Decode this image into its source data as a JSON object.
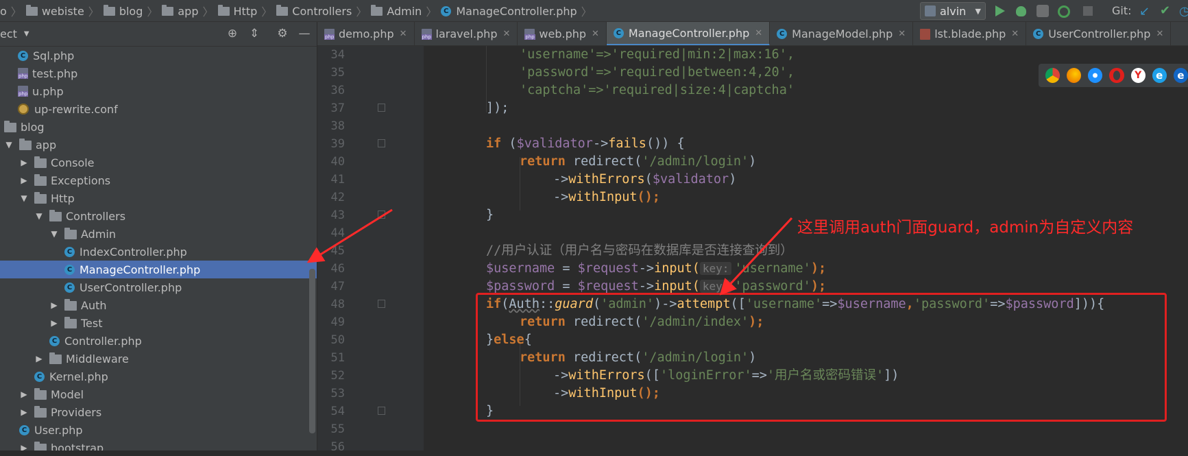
{
  "breadcrumbs": [
    "webiste",
    "blog",
    "app",
    "Http",
    "Controllers",
    "Admin",
    "ManageController.php"
  ],
  "breadcrumb_lead": "o",
  "toolbar": {
    "run_config": "alvin",
    "git_label": "Git:"
  },
  "project_panel": {
    "title": "ect",
    "items": [
      {
        "label": "Sql.php",
        "icon": "class-icon",
        "arrow": ""
      },
      {
        "label": "test.php",
        "icon": "php-file-icon",
        "arrow": ""
      },
      {
        "label": "u.php",
        "icon": "php-file-icon",
        "arrow": ""
      },
      {
        "label": "up-rewrite.conf",
        "icon": "config-file-icon",
        "arrow": ""
      },
      {
        "label": "blog",
        "icon": "folder-icon",
        "arrow": ""
      },
      {
        "label": "app",
        "icon": "folder-icon",
        "arrow": "expanded"
      },
      {
        "label": "Console",
        "icon": "folder-icon",
        "arrow": "collapsed"
      },
      {
        "label": "Exceptions",
        "icon": "folder-icon",
        "arrow": "collapsed"
      },
      {
        "label": "Http",
        "icon": "folder-icon",
        "arrow": "expanded"
      },
      {
        "label": "Controllers",
        "icon": "folder-icon",
        "arrow": "expanded"
      },
      {
        "label": "Admin",
        "icon": "folder-icon",
        "arrow": "expanded"
      },
      {
        "label": "IndexController.php",
        "icon": "class-icon",
        "arrow": ""
      },
      {
        "label": "ManageController.php",
        "icon": "class-icon",
        "arrow": "",
        "selected": true
      },
      {
        "label": "UserController.php",
        "icon": "class-icon",
        "arrow": ""
      },
      {
        "label": "Auth",
        "icon": "folder-icon",
        "arrow": "collapsed"
      },
      {
        "label": "Test",
        "icon": "folder-icon",
        "arrow": "collapsed"
      },
      {
        "label": "Controller.php",
        "icon": "class-icon",
        "arrow": ""
      },
      {
        "label": "Middleware",
        "icon": "folder-icon",
        "arrow": "collapsed"
      },
      {
        "label": "Kernel.php",
        "icon": "class-icon",
        "arrow": ""
      },
      {
        "label": "Model",
        "icon": "folder-icon",
        "arrow": "collapsed"
      },
      {
        "label": "Providers",
        "icon": "folder-icon",
        "arrow": "collapsed"
      },
      {
        "label": "User.php",
        "icon": "class-icon",
        "arrow": ""
      },
      {
        "label": "bootstrap",
        "icon": "folder-icon",
        "arrow": "collapsed"
      }
    ]
  },
  "tabs": [
    {
      "label": "demo.php",
      "icon": "php-file-icon"
    },
    {
      "label": "laravel.php",
      "icon": "php-file-icon"
    },
    {
      "label": "web.php",
      "icon": "php-file-icon"
    },
    {
      "label": "ManageController.php",
      "icon": "class-icon",
      "active": true
    },
    {
      "label": "ManageModel.php",
      "icon": "class-icon"
    },
    {
      "label": "lst.blade.php",
      "icon": "blade-file-icon"
    },
    {
      "label": "UserController.php",
      "icon": "class-icon"
    }
  ],
  "code": {
    "line_numbers": [
      "34",
      "35",
      "36",
      "37",
      "38",
      "39",
      "40",
      "41",
      "42",
      "43",
      "44",
      "45",
      "46",
      "47",
      "48",
      "49",
      "50",
      "51",
      "52",
      "53",
      "54",
      "55",
      "56"
    ],
    "l34": "'username'=>'required|min:2|max:16',",
    "l35": "'password'=>'required|between:4,20',",
    "l36": "'captcha'=>'required|size:4|captcha'",
    "l37": "]);",
    "l39_kw": "if",
    "l39_rest1": " (",
    "l39_var": "$validator",
    "l39_arrow": "->",
    "l39_fn": "fails",
    "l39_rest2": "()) {",
    "l40_kw": "return",
    "l40_rest": " redirect(",
    "l40_str": "'/admin/login'",
    "l40_end": ")",
    "l41_arrow": "->",
    "l41_fn": "withErrors",
    "l41_p1": "(",
    "l41_var": "$validator",
    "l41_p2": ")",
    "l42_arrow": "->",
    "l42_fn": "withInput",
    "l42_end": "();",
    "l43": "}",
    "l45": "//用户认证（用户名与密码在数据库是否连接查询到）",
    "l46_var": "$username",
    "l46_eq": " = ",
    "l46_var2": "$request",
    "l46_arrow": "->",
    "l46_fn": "input(",
    "l46_hint": "key:",
    "l46_str": "'username'",
    "l46_end": ");",
    "l47_var": "$password",
    "l47_eq": " = ",
    "l47_var2": "$request",
    "l47_arrow": "->",
    "l47_fn": "input(",
    "l47_hint": "key:",
    "l47_str": "'password'",
    "l47_end": ");",
    "l48_kw": "if",
    "l48_p": "(",
    "l48_cls": "Auth",
    "l48_dc": "::",
    "l48_fn": "guard",
    "l48_a": "(",
    "l48_s1": "'admin'",
    "l48_b": ")->",
    "l48_fn2": "attempt",
    "l48_c": "([",
    "l48_s2": "'username'",
    "l48_d": "=>",
    "l48_v1": "$username",
    "l48_e": ",",
    "l48_s3": "'password'",
    "l48_f": "=>",
    "l48_v2": "$password",
    "l48_g": "])){",
    "l49_kw": "return",
    "l49_rest": " redirect(",
    "l49_str": "'/admin/index'",
    "l49_end": ");",
    "l50_a": "}",
    "l50_kw": "else",
    "l50_b": "{",
    "l51_kw": "return",
    "l51_rest": " redirect(",
    "l51_str": "'/admin/login'",
    "l51_end": ")",
    "l52_arrow": "->",
    "l52_fn": "withErrors",
    "l52_a": "([",
    "l52_s1": "'loginError'",
    "l52_b": "=>",
    "l52_s2": "'用户名或密码错误'",
    "l52_c": "])",
    "l53_arrow": "->",
    "l53_fn": "withInput",
    "l53_end": "();",
    "l54": "}"
  },
  "annotation": "这里调用auth门面guard，admin为自定义内容",
  "colors": {
    "annotation_red": "#e02020",
    "selection_blue": "#4b6eaf",
    "keyword": "#cc7832",
    "string": "#6a8759",
    "variable": "#9876aa",
    "function": "#ffc66d"
  },
  "browser_icons": [
    "chrome-icon",
    "firefox-icon",
    "safari-icon",
    "opera-icon",
    "yandex-icon",
    "ie-icon",
    "edge-icon"
  ]
}
